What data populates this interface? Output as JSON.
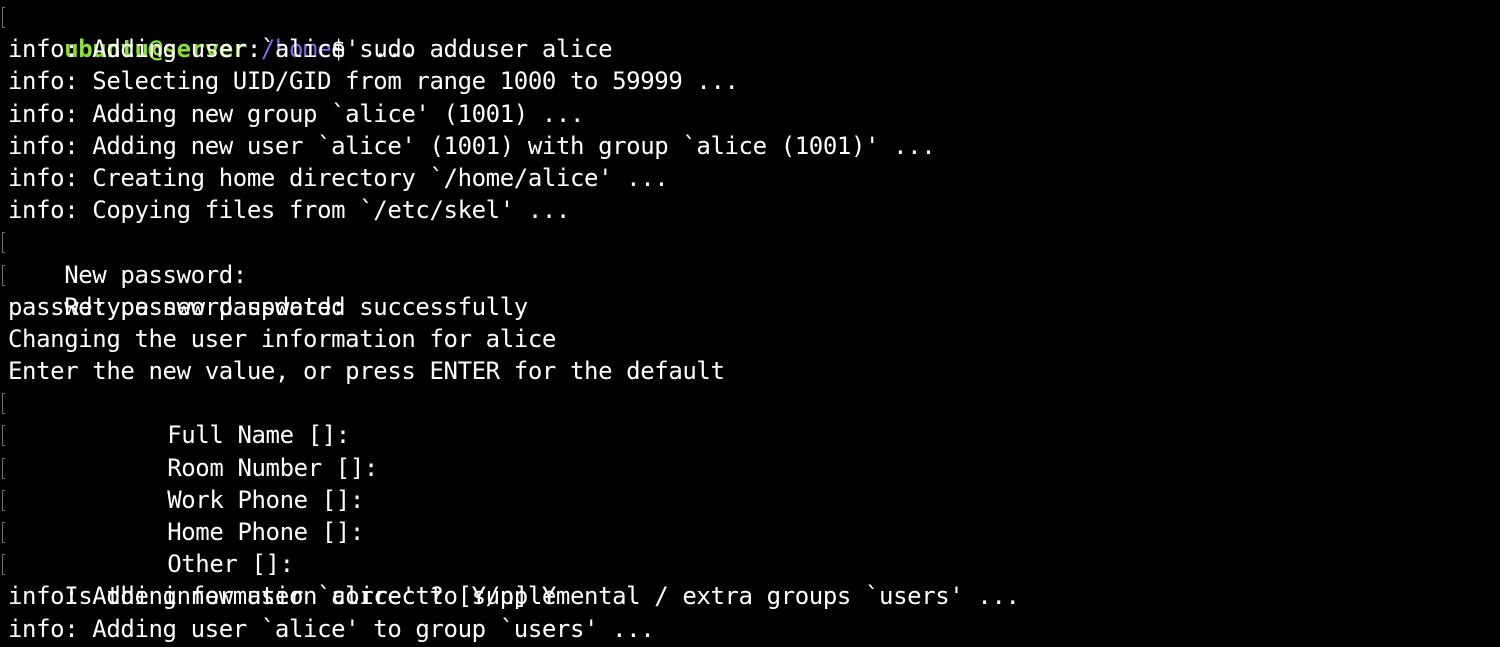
{
  "colors": {
    "background": "#000000",
    "text": "#ffffff",
    "prompt_user": "#8ae234",
    "prompt_path": "#7b6cf0",
    "line_marker": "#6e6e6e"
  },
  "prompt": {
    "user_host": "ubuntu@server",
    "separator": ":",
    "path": "/home",
    "symbol": "$ ",
    "command": "sudo adduser alice"
  },
  "output": [
    "info: Adding user `alice' ...",
    "info: Selecting UID/GID from range 1000 to 59999 ...",
    "info: Adding new group `alice' (1001) ...",
    "info: Adding new user `alice' (1001) with group `alice (1001)' ...",
    "info: Creating home directory `/home/alice' ...",
    "info: Copying files from `/etc/skel' ...",
    "New password:",
    "Retype new password:",
    "passwd: password updated successfully",
    "Changing the user information for alice",
    "Enter the new value, or press ENTER for the default",
    "Full Name []:",
    "Room Number []:",
    "Work Phone []:",
    "Home Phone []:",
    "Other []:",
    "Is the information correct? [Y/n] Y",
    "info: Adding new user `alice' to supplemental / extra groups `users' ...",
    "info: Adding user `alice' to group `users' ..."
  ]
}
